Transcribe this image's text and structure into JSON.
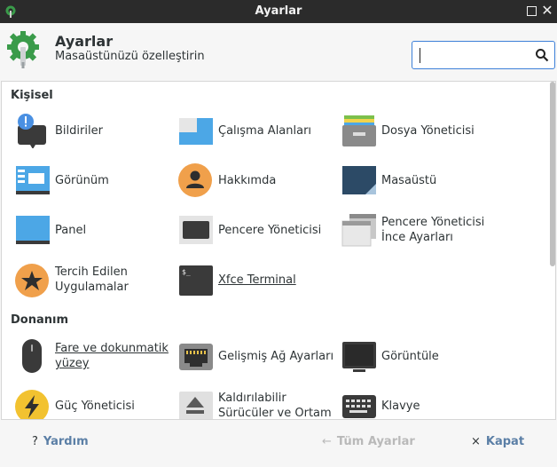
{
  "window": {
    "title": "Ayarlar"
  },
  "header": {
    "title": "Ayarlar",
    "subtitle": "Masaüstünüzü özelleştirin",
    "search_placeholder": ""
  },
  "sections": [
    {
      "title": "Kişisel",
      "items": [
        {
          "label": "Bildiriler"
        },
        {
          "label": "Çalışma Alanları"
        },
        {
          "label": "Dosya Yöneticisi"
        },
        {
          "label": "Görünüm"
        },
        {
          "label": "Hakkımda"
        },
        {
          "label": "Masaüstü"
        },
        {
          "label": "Panel"
        },
        {
          "label": "Pencere Yöneticisi"
        },
        {
          "label": "Pencere Yöneticisi İnce Ayarları"
        },
        {
          "label": "Tercih Edilen Uygulamalar"
        },
        {
          "label": "Xfce Terminal"
        }
      ]
    },
    {
      "title": "Donanım",
      "items": [
        {
          "label": "Fare ve dokunmatik yüzey"
        },
        {
          "label": "Gelişmiş Ağ Ayarları"
        },
        {
          "label": "Görüntüle"
        },
        {
          "label": "Güç Yöneticisi"
        },
        {
          "label": "Kaldırılabilir Sürücüler ve Ortam"
        },
        {
          "label": "Klavye"
        }
      ]
    }
  ],
  "footer": {
    "help": "Yardım",
    "all_settings": "Tüm Ayarlar",
    "close": "Kapat"
  }
}
